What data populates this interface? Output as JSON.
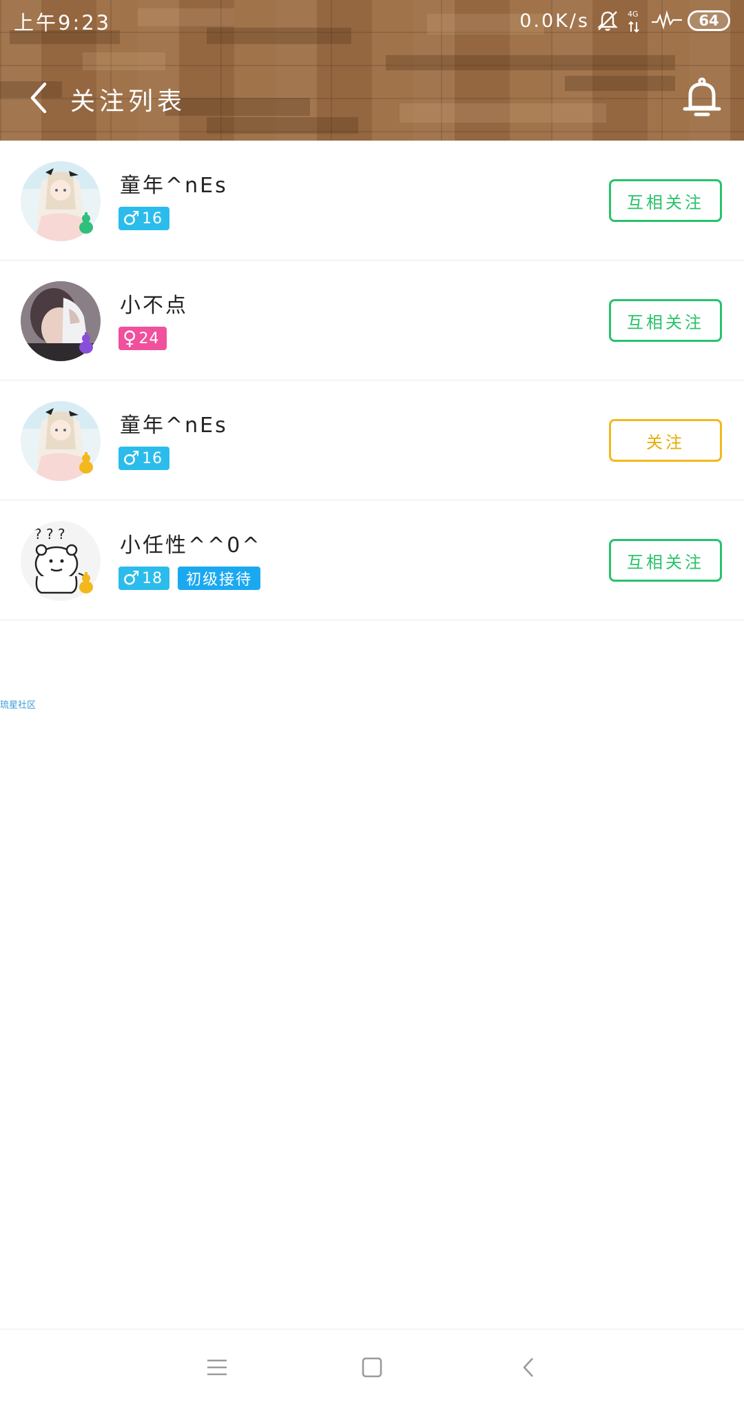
{
  "status_bar": {
    "time": "上午9:23",
    "net_speed": "0.0K/s",
    "network_label": "4G",
    "battery": "64"
  },
  "header": {
    "title": "关注列表",
    "back_icon": "chevron-left-icon",
    "bell_icon": "bell-icon"
  },
  "follow_list": [
    {
      "name": "童年^nEs",
      "gender": "♂",
      "age": "16",
      "gender_color": "#2bbcec",
      "level_tag": "",
      "badge_color": "#2ec07c",
      "follow_label": "互相关注",
      "follow_color": "#27c26a"
    },
    {
      "name": "小不点",
      "gender": "♀",
      "age": "24",
      "gender_color": "#f0509c",
      "level_tag": "",
      "badge_color": "#8a4fd8",
      "follow_label": "互相关注",
      "follow_color": "#27c26a"
    },
    {
      "name": "童年^nEs",
      "gender": "♂",
      "age": "16",
      "gender_color": "#2bbcec",
      "level_tag": "",
      "badge_color": "#f2b81c",
      "follow_label": "关注",
      "follow_color": "#f2b81c"
    },
    {
      "name": "小任性^^0^",
      "gender": "♂",
      "age": "18",
      "gender_color": "#2bbcec",
      "level_tag": "初级接待",
      "badge_color": "#f2b81c",
      "follow_label": "互相关注",
      "follow_color": "#27c26a"
    }
  ],
  "watermark": "琉星社区",
  "nav_bar": {
    "menu_icon": "menu-icon",
    "home_icon": "home-square-icon",
    "back_icon": "back-triangle-icon"
  }
}
